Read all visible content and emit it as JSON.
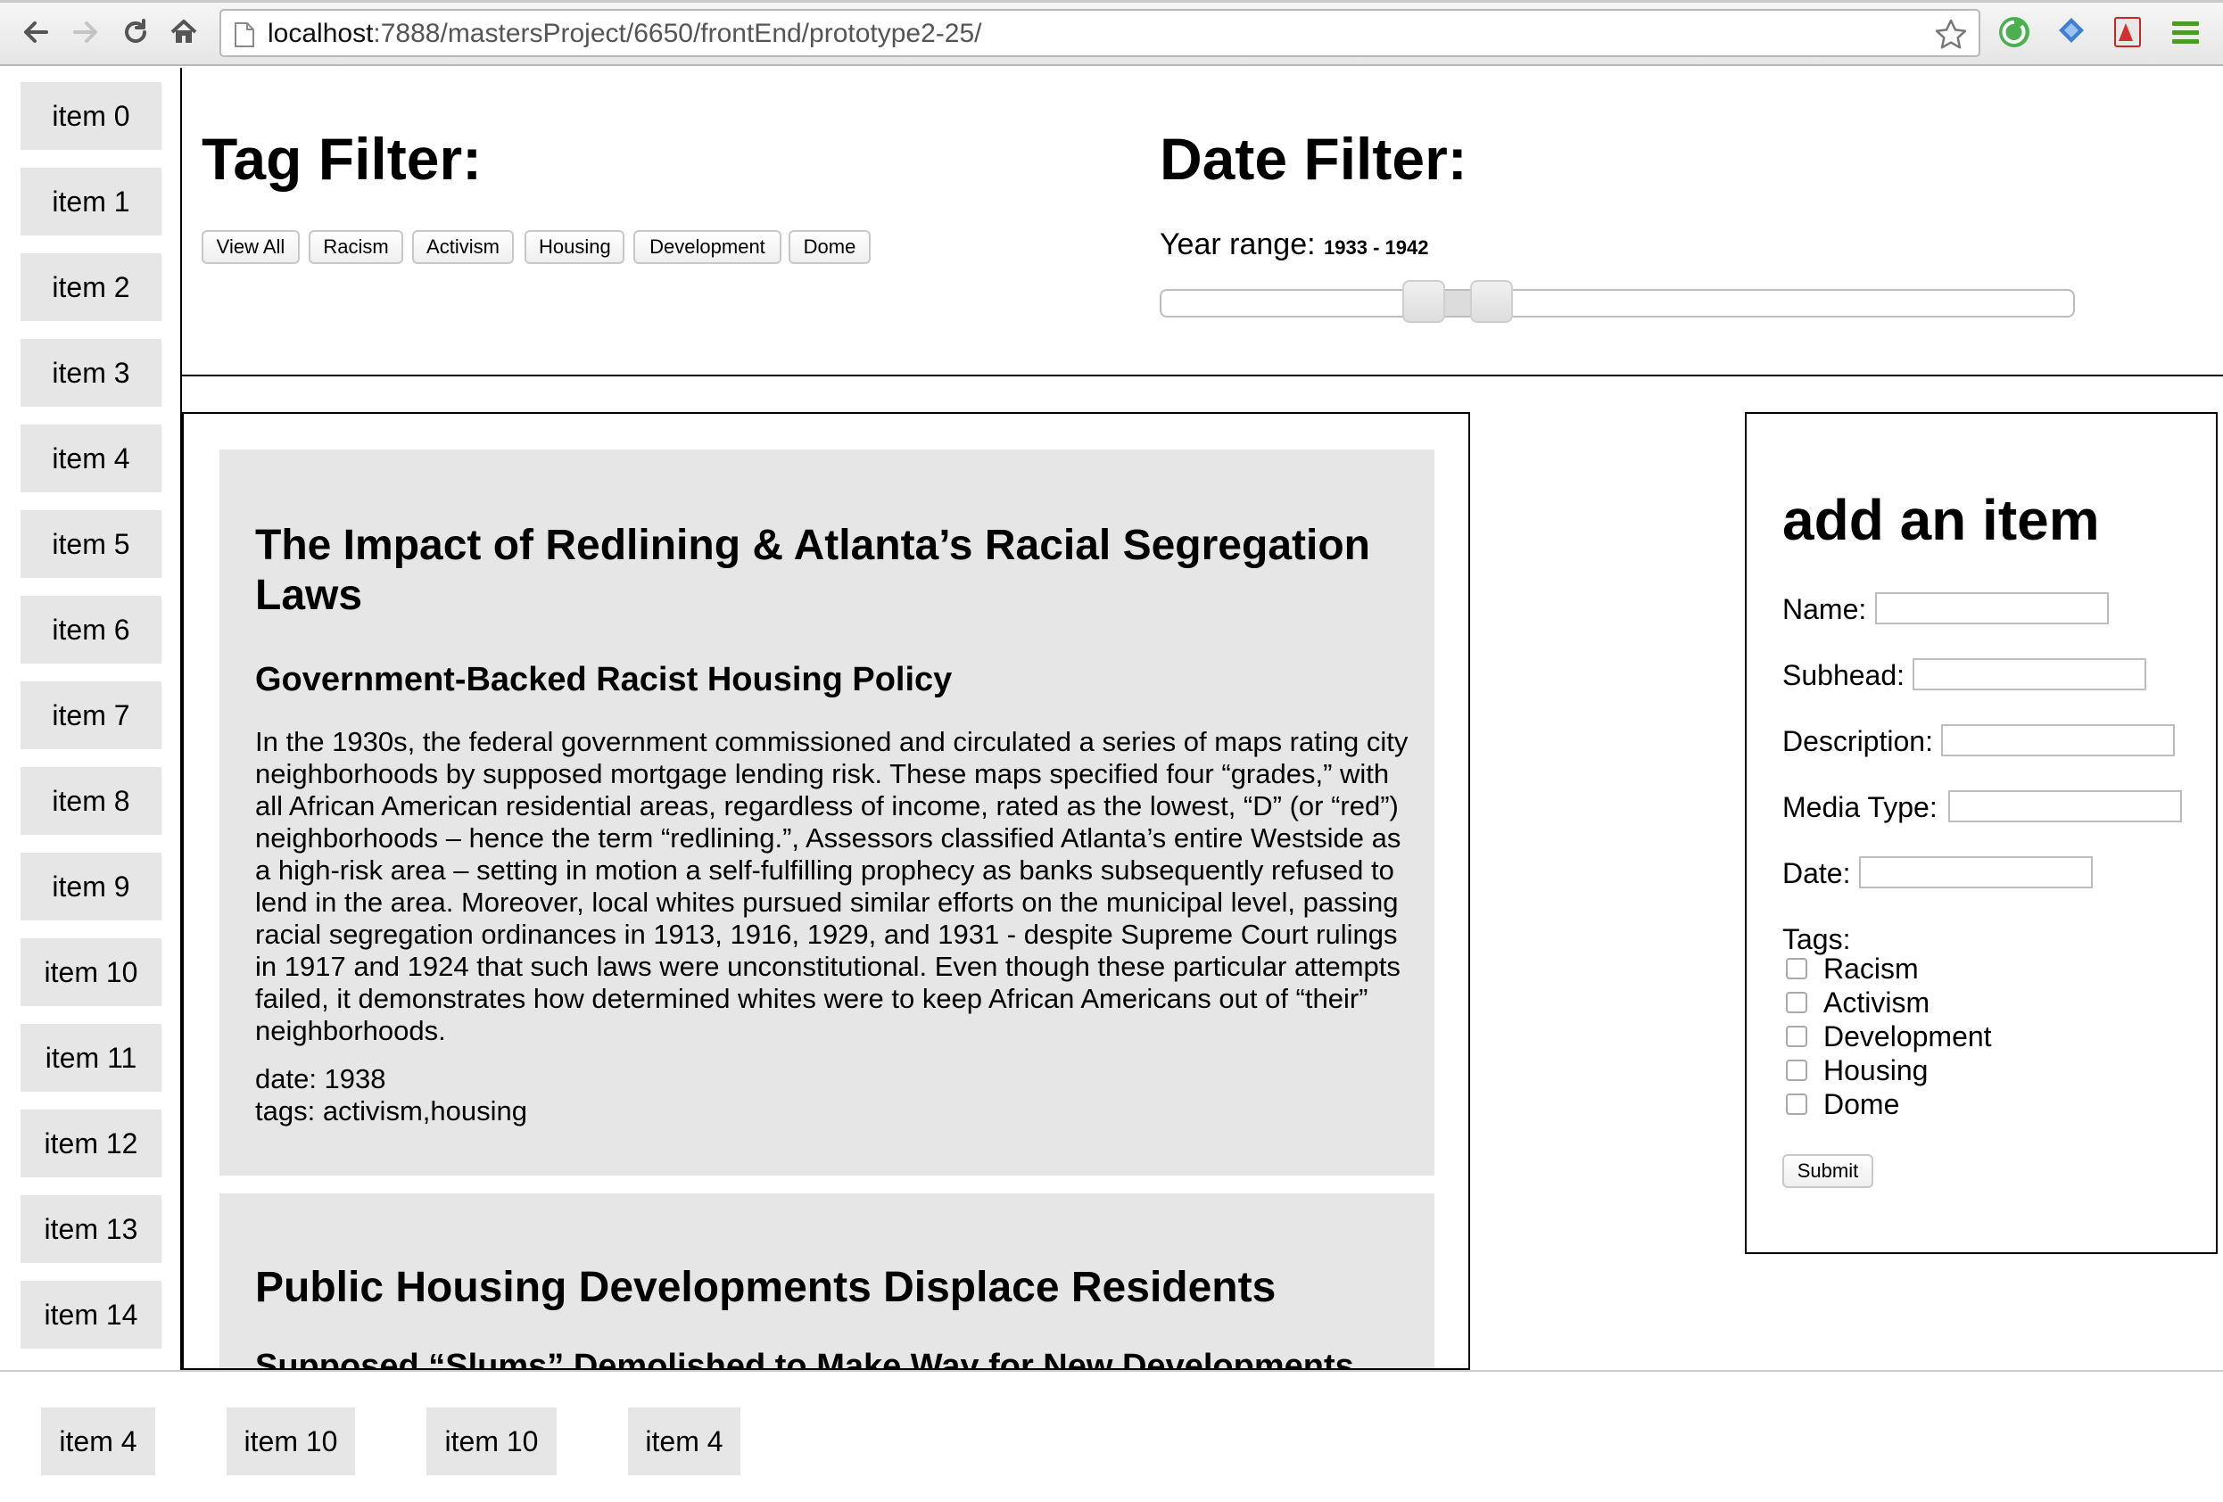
{
  "browser": {
    "url_host": "localhost",
    "url_path": ":7888/mastersProject/6650/frontEnd/prototype2-25/"
  },
  "sidebar": {
    "items": [
      "item 0",
      "item 1",
      "item 2",
      "item 3",
      "item 4",
      "item 5",
      "item 6",
      "item 7",
      "item 8",
      "item 9",
      "item 10",
      "item 11",
      "item 12",
      "item 13",
      "item 14"
    ]
  },
  "tag_filter": {
    "title": "Tag Filter:",
    "buttons": [
      "View All",
      "Racism",
      "Activism",
      "Housing",
      "Development",
      "Dome"
    ]
  },
  "date_filter": {
    "title": "Date Filter:",
    "year_label": "Year range:",
    "year_range": "1933 - 1942",
    "range_min_year": 1933,
    "range_max_year": 1942
  },
  "articles": [
    {
      "title": "The Impact of Redlining & Atlanta’s Racial Segregation Laws",
      "subhead": "Government-Backed Racist Housing Policy",
      "description": "In the 1930s, the federal government commissioned and circulated a series of maps rating city neighborhoods by supposed mortgage lending risk. These maps specified four “grades,” with all African American residential areas, regardless of income, rated as the lowest, “D” (or “red”) neighborhoods – hence the term “redlining.”, Assessors classified Atlanta’s entire Westside as a high-risk area – setting in motion a self-fulfilling prophecy as banks subsequently refused to lend in the area. Moreover, local whites pursued similar efforts on the municipal level, passing racial segregation ordinances in 1913, 1916, 1929, and 1931 - despite Supreme Court rulings in 1917 and 1924 that such laws were unconstitutional. Even though these particular attempts failed, it demonstrates how determined whites were to keep African Americans out of “their” neighborhoods.",
      "date": "date: 1938",
      "tags": "tags: activism,housing"
    },
    {
      "title": "Public Housing Developments Displace Residents",
      "subhead": "Supposed “Slums” Demolished to Make Way for New Developments"
    }
  ],
  "add_form": {
    "title": "add an item",
    "name_label": "Name:",
    "subhead_label": "Subhead:",
    "description_label": "Description:",
    "media_type_label": "Media Type:",
    "date_label": "Date:",
    "tags_label": "Tags:",
    "tags": [
      "Racism",
      "Activism",
      "Development",
      "Housing",
      "Dome"
    ],
    "submit_label": "Submit"
  },
  "dock": {
    "items": [
      "item 4",
      "item 10",
      "item 10",
      "item 4"
    ]
  }
}
